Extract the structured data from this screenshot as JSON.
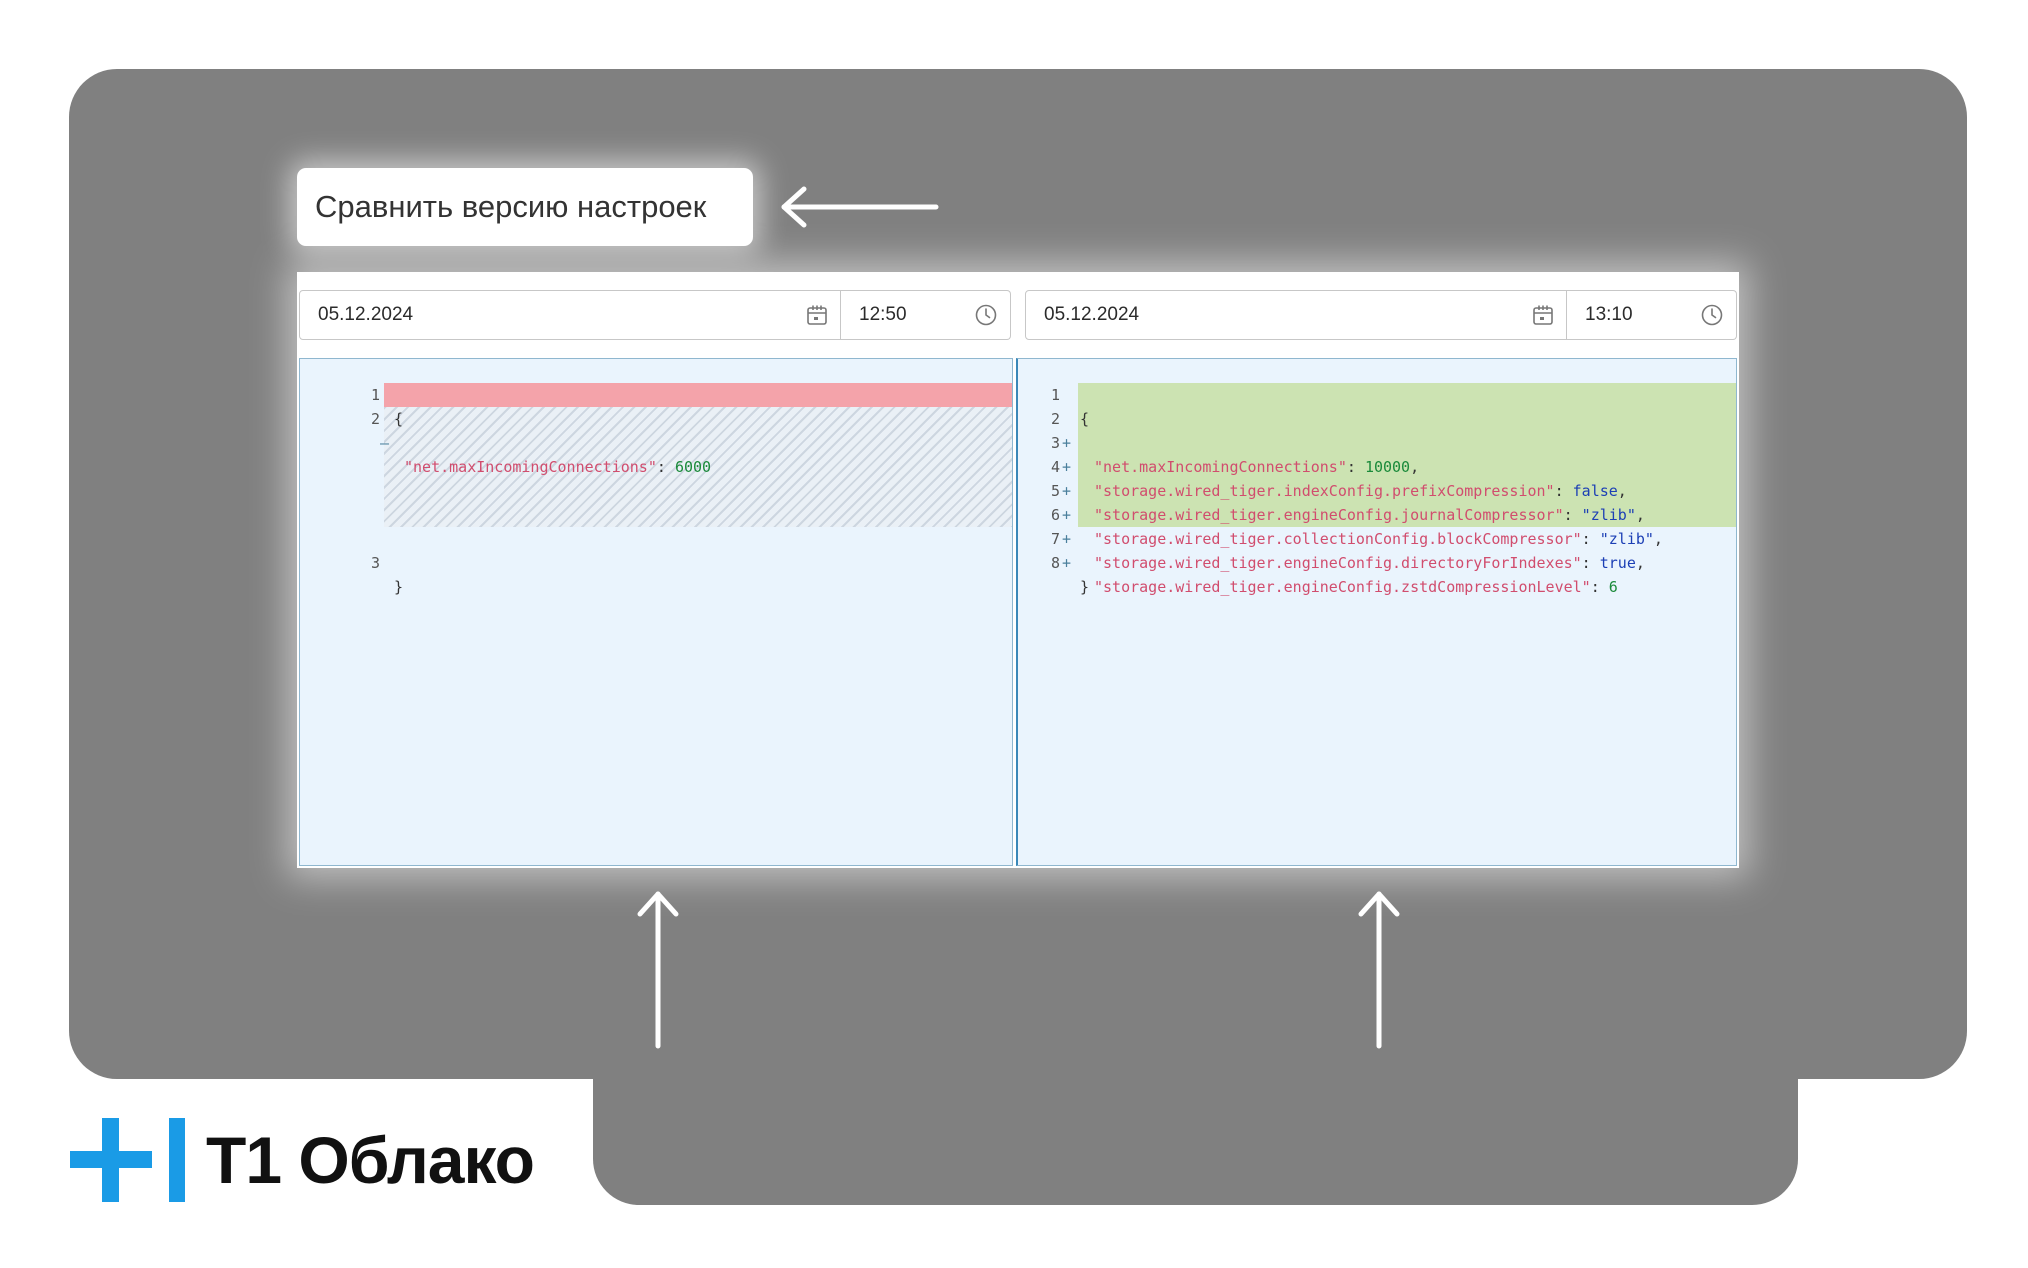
{
  "compare_button": {
    "label": "Сравнить версию настроек"
  },
  "left_picker": {
    "date": "05.12.2024",
    "time": "12:50"
  },
  "right_picker": {
    "date": "05.12.2024",
    "time": "13:10"
  },
  "left_diff": {
    "lines": [
      {
        "num": "1",
        "mark": "",
        "text": "{"
      },
      {
        "num": "2",
        "mark": "–",
        "key": "\"net.maxIncomingConnections\"",
        "sep": ": ",
        "value": "6000"
      },
      {
        "num": "3",
        "mark": "",
        "text": "}"
      }
    ]
  },
  "right_diff": {
    "lines": [
      {
        "num": "1",
        "mark": "",
        "text": "{"
      },
      {
        "num": "2",
        "mark": "+",
        "key": "\"net.maxIncomingConnections\"",
        "sep": ": ",
        "value": "10000",
        "end": ","
      },
      {
        "num": "3",
        "mark": "+",
        "key": "\"storage.wired_tiger.indexConfig.prefixCompression\"",
        "sep": ": ",
        "value": "false",
        "end": ","
      },
      {
        "num": "4",
        "mark": "+",
        "key": "\"storage.wired_tiger.engineConfig.journalCompressor\"",
        "sep": ": ",
        "value": "\"zlib\"",
        "end": ","
      },
      {
        "num": "5",
        "mark": "+",
        "key": "\"storage.wired_tiger.collectionConfig.blockCompressor\"",
        "sep": ": ",
        "value": "\"zlib\"",
        "end": ","
      },
      {
        "num": "6",
        "mark": "+",
        "key": "\"storage.wired_tiger.engineConfig.directoryForIndexes\"",
        "sep": ": ",
        "value": "true",
        "end": ","
      },
      {
        "num": "7",
        "mark": "+",
        "key": "\"storage.wired_tiger.engineConfig.zstdCompressionLevel\"",
        "sep": ": ",
        "value": "6",
        "end": ""
      },
      {
        "num": "8",
        "mark": "",
        "text": "}"
      }
    ]
  },
  "brand": {
    "name": "T1 Облако",
    "accent_color": "#1a9be6"
  },
  "colors": {
    "deleted": "#f4a3aa",
    "added": "#cce3b2",
    "pane": "#eaf4fd",
    "backdrop": "#808080"
  }
}
